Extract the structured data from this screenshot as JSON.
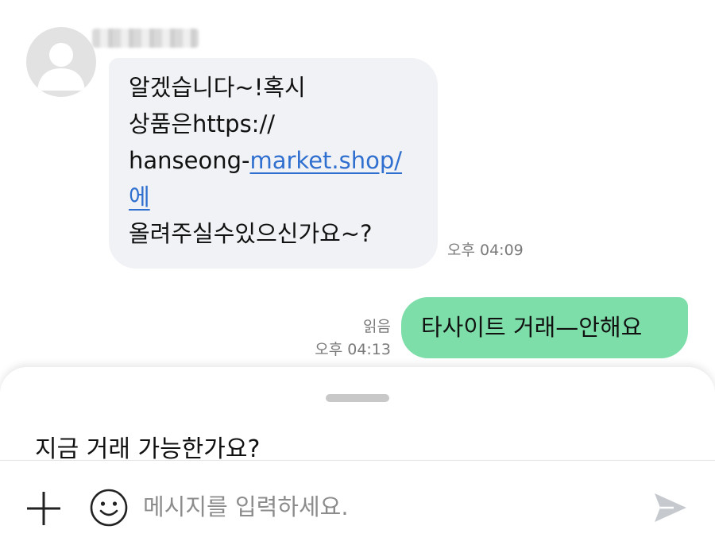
{
  "incoming": {
    "lines": [
      "알겠습니다~!혹시",
      "상품은https://",
      "hanseong-",
      "market.shop/",
      "에",
      "올려주실수있으신가요~?"
    ],
    "time": "오후 04:09"
  },
  "outgoing": {
    "text": "타사이트 거래—안해요",
    "read_status": "읽음",
    "time": "오후 04:13"
  },
  "composer": {
    "suggestion": "지금 거래 가능한가요?",
    "placeholder": "메시지를 입력하세요."
  },
  "colors": {
    "incoming_bubble": "#f1f2f5",
    "outgoing_bubble": "#7ddea9",
    "link": "#2f6fd0"
  },
  "icons": {
    "avatar": "default-person-icon",
    "attach": "plus-icon",
    "emoji": "smiley-icon",
    "send": "send-arrow-icon"
  }
}
